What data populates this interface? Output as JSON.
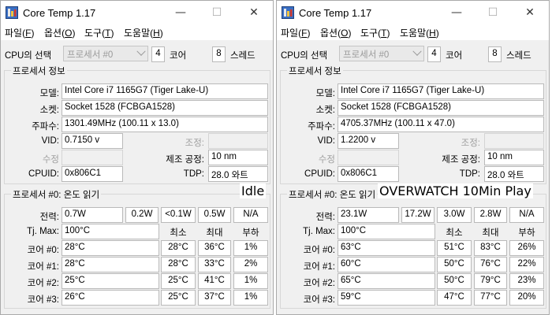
{
  "windows": [
    {
      "title": "Core Temp 1.17",
      "menu": {
        "file": "파일",
        "file_key": "F",
        "options": "옵션",
        "options_key": "O",
        "tools": "도구",
        "tools_key": "T",
        "help": "도움말",
        "help_key": "H"
      },
      "cpu_select_label": "CPU의 선택",
      "processor_combo": "프로세서 #0",
      "cores_value": "4",
      "cores_label": "코어",
      "threads_value": "8",
      "threads_label": "스레드",
      "info_group": "프로세서 정보",
      "model_label": "모델:",
      "model_value": "Intel Core i7 1165G7 (Tiger Lake-U)",
      "socket_label": "소켓:",
      "socket_value": "Socket 1528 (FCBGA1528)",
      "freq_label": "주파수:",
      "freq_value": "1301.49MHz (100.11 x 13.0)",
      "vid_label": "VID:",
      "vid_value": "0.7150 v",
      "adjust_label": "조정:",
      "rev_label": "수정",
      "lith_label": "제조 공정:",
      "lith_value": "10 nm",
      "cpuid_label": "CPUID:",
      "cpuid_value": "0x806C1",
      "tdp_label": "TDP:",
      "tdp_value": "28.0 와트",
      "temp_group": "프로세서 #0: 온도 읽기",
      "power_label": "전력:",
      "power_values": [
        "0.7W",
        "0.2W",
        "<0.1W",
        "0.5W",
        "N/A"
      ],
      "tjmax_label": "Tj. Max:",
      "tjmax_value": "100°C",
      "min_label": "최소",
      "max_label": "최대",
      "load_label": "부하",
      "cores": [
        {
          "label": "코어 #0:",
          "temp": "28°C",
          "min": "28°C",
          "max": "36°C",
          "load": "1%"
        },
        {
          "label": "코어 #1:",
          "temp": "28°C",
          "min": "28°C",
          "max": "33°C",
          "load": "2%"
        },
        {
          "label": "코어 #2:",
          "temp": "25°C",
          "min": "25°C",
          "max": "41°C",
          "load": "1%"
        },
        {
          "label": "코어 #3:",
          "temp": "26°C",
          "min": "25°C",
          "max": "37°C",
          "load": "1%"
        }
      ],
      "caption": "Idle"
    },
    {
      "title": "Core Temp 1.17",
      "menu": {
        "file": "파일",
        "file_key": "F",
        "options": "옵션",
        "options_key": "O",
        "tools": "도구",
        "tools_key": "T",
        "help": "도움말",
        "help_key": "H"
      },
      "cpu_select_label": "CPU의 선택",
      "processor_combo": "프로세서 #0",
      "cores_value": "4",
      "cores_label": "코어",
      "threads_value": "8",
      "threads_label": "스레드",
      "info_group": "프로세서 정보",
      "model_label": "모델:",
      "model_value": "Intel Core i7 1165G7 (Tiger Lake-U)",
      "socket_label": "소켓:",
      "socket_value": "Socket 1528 (FCBGA1528)",
      "freq_label": "주파수:",
      "freq_value": "4705.37MHz (100.11 x 47.0)",
      "vid_label": "VID:",
      "vid_value": "1.2200 v",
      "adjust_label": "조정:",
      "rev_label": "수정",
      "lith_label": "제조 공정:",
      "lith_value": "10 nm",
      "cpuid_label": "CPUID:",
      "cpuid_value": "0x806C1",
      "tdp_label": "TDP:",
      "tdp_value": "28.0 와트",
      "temp_group": "프로세서 #0: 온도 읽기",
      "power_label": "전력:",
      "power_values": [
        "23.1W",
        "17.2W",
        "3.0W",
        "2.8W",
        "N/A"
      ],
      "tjmax_label": "Tj. Max:",
      "tjmax_value": "100°C",
      "min_label": "최소",
      "max_label": "최대",
      "load_label": "부하",
      "cores": [
        {
          "label": "코어 #0:",
          "temp": "63°C",
          "min": "51°C",
          "max": "83°C",
          "load": "26%"
        },
        {
          "label": "코어 #1:",
          "temp": "60°C",
          "min": "50°C",
          "max": "76°C",
          "load": "22%"
        },
        {
          "label": "코어 #2:",
          "temp": "65°C",
          "min": "50°C",
          "max": "79°C",
          "load": "23%"
        },
        {
          "label": "코어 #3:",
          "temp": "59°C",
          "min": "47°C",
          "max": "77°C",
          "load": "20%"
        }
      ],
      "caption": "OVERWATCH 10Min Play"
    }
  ],
  "titlebar_buttons": {
    "minimize": "—",
    "maximize": "☐",
    "close": "✕"
  }
}
